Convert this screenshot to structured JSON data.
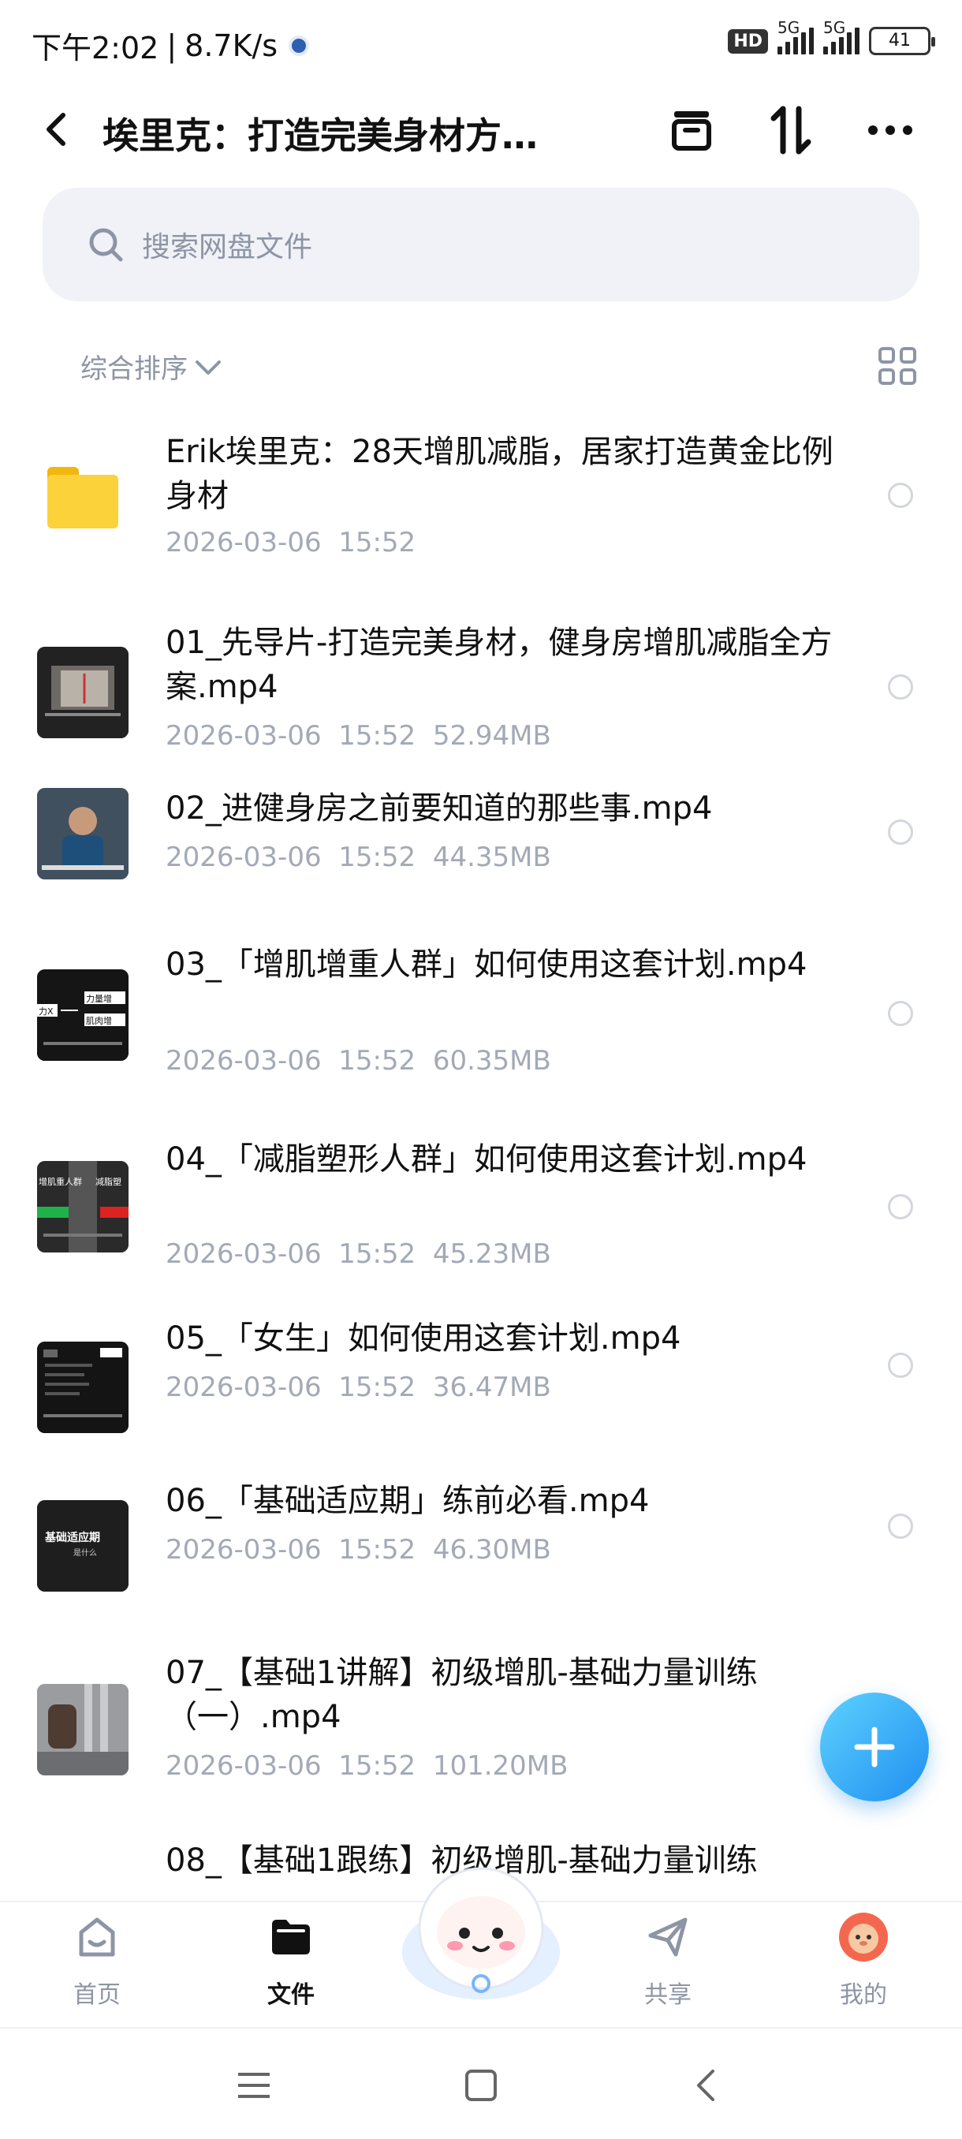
{
  "status_bar": {
    "time": "下午2:02",
    "speed": "8.7K/s",
    "net1": "5G",
    "net2": "5G",
    "hd": "HD",
    "battery": "41"
  },
  "header": {
    "title": "埃里克：打造完美身材方…"
  },
  "search": {
    "placeholder": "搜索网盘文件"
  },
  "sort": {
    "label": "综合排序"
  },
  "files": [
    {
      "type": "folder",
      "name": "Erik埃里克：28天增肌减脂，居家打造黄金比例身材",
      "date": "2026-03-06  15:52",
      "size": ""
    },
    {
      "type": "video",
      "name": "01_先导片-打造完美身材，健身房增肌减脂全方案.mp4",
      "date": "2026-03-06  15:52",
      "size": "52.94MB"
    },
    {
      "type": "video",
      "name": "02_进健身房之前要知道的那些事.mp4",
      "date": "2026-03-06  15:52",
      "size": "44.35MB"
    },
    {
      "type": "video",
      "name": "03_「增肌增重人群」如何使用这套计划.mp4",
      "date": "2026-03-06  15:52",
      "size": "60.35MB"
    },
    {
      "type": "video",
      "name": "04_「减脂塑形人群」如何使用这套计划.mp4",
      "date": "2026-03-06  15:52",
      "size": "45.23MB"
    },
    {
      "type": "video",
      "name": "05_「女生」如何使用这套计划.mp4",
      "date": "2026-03-06  15:52",
      "size": "36.47MB"
    },
    {
      "type": "video",
      "name": "06_「基础适应期」练前必看.mp4",
      "date": "2026-03-06  15:52",
      "size": "46.30MB"
    },
    {
      "type": "video",
      "name": "07_【基础1讲解】初级增肌-基础力量训练（一）.mp4",
      "date": "2026-03-06  15:52",
      "size": "101.20MB"
    },
    {
      "type": "video",
      "name": "08_【基础1跟练】初级增肌-基础力量训练",
      "date": "",
      "size": ""
    }
  ],
  "thumb_texts": {
    "t3a": "力量增",
    "t3b": "肌肉增",
    "t3c": "力X",
    "t4a": "增肌重人群",
    "t4b": "减脂塑",
    "t6a": "基础适应期",
    "t6b": "是什么"
  },
  "bottom_nav": [
    {
      "label": "首页",
      "icon": "home-icon"
    },
    {
      "label": "文件",
      "icon": "folder-icon"
    },
    {
      "label": "共享",
      "icon": "send-icon"
    },
    {
      "label": "我的",
      "icon": "avatar-icon"
    }
  ],
  "colors": {
    "accent": "#1f8ff0",
    "folder": "#fcd23a",
    "muted": "#8d95a5"
  }
}
